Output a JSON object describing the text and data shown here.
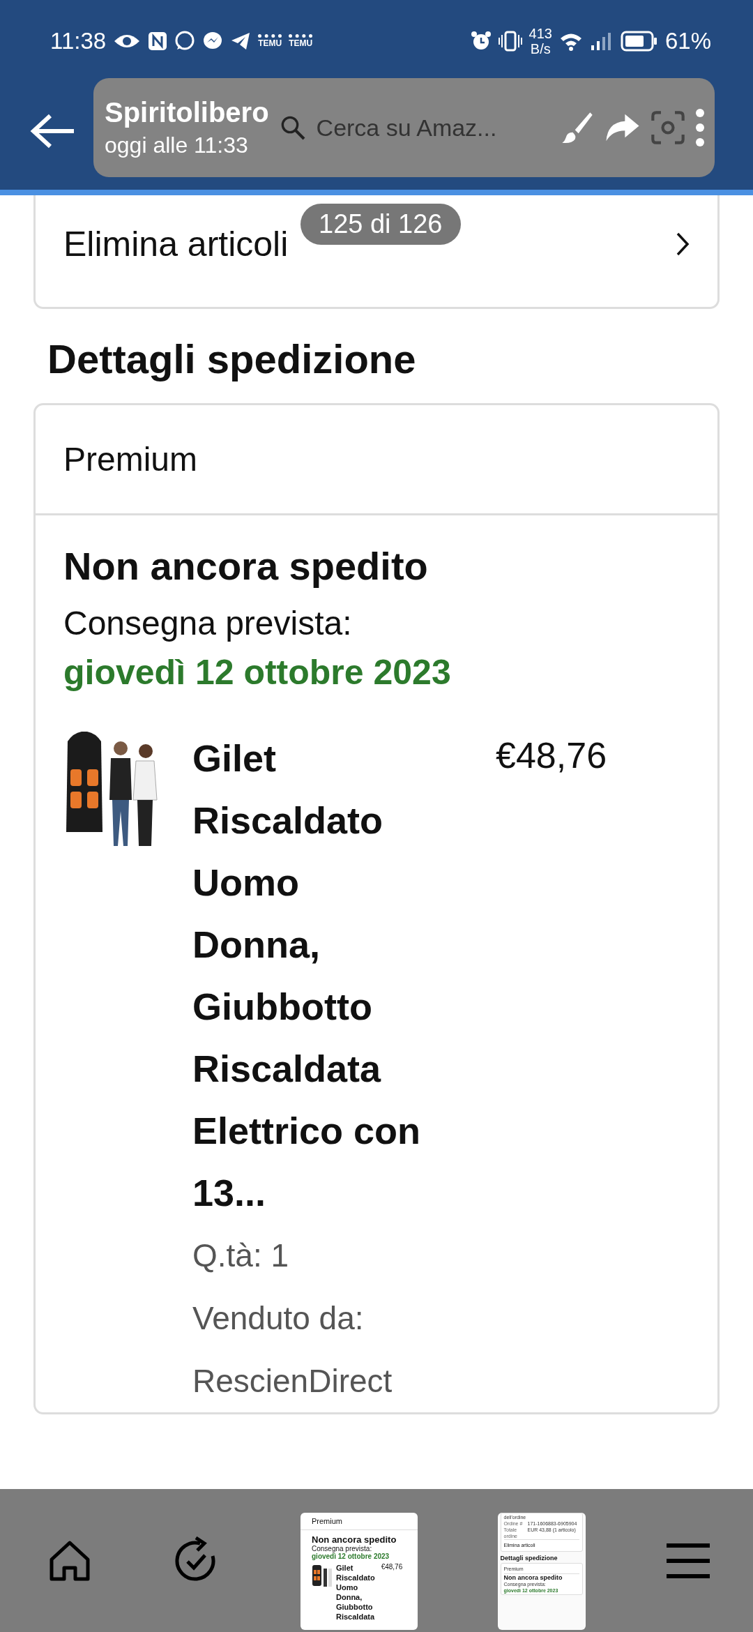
{
  "status_bar": {
    "time": "11:38",
    "app_labels": [
      "TEMU",
      "TEMU"
    ],
    "net_speed": [
      "413",
      "B/s"
    ],
    "battery": "61%"
  },
  "search": {
    "placeholder": "Cerca su Amaz..."
  },
  "viewer": {
    "sender": "Spiritolibero",
    "sent": "oggi alle 11:33",
    "counter": "125 di 126"
  },
  "order_card": {
    "action": "Elimina articoli"
  },
  "shipping": {
    "title": "Dettagli spedizione",
    "method": "Premium",
    "status": "Non ancora spedito",
    "delivery_label": "Consegna prevista:",
    "delivery_date": "giovedì 12 ottobre 2023",
    "items": [
      {
        "title_lines": [
          "Gilet",
          "Riscaldato",
          "Uomo",
          "Donna,",
          "Giubbotto",
          "Riscaldata",
          "Elettrico con",
          "13..."
        ],
        "price": "€48,76",
        "quantity": "Q.tà: 1",
        "seller_label": "Venduto da:",
        "seller": "RescienDirect"
      }
    ]
  },
  "thumbnails": [
    {
      "kind": "shipment",
      "method": "Premium",
      "status": "Non ancora spedito",
      "delivery_label": "Consegna prevista:",
      "delivery_date": "giovedì 12 ottobre 2023",
      "title_lines": [
        "Gilet",
        "Riscaldato",
        "Uomo",
        "Donna,",
        "Giubbotto",
        "Riscaldata"
      ],
      "price": "€48,76"
    },
    {
      "kind": "order",
      "caption": "dell'ordine",
      "rows": [
        {
          "label": "Ordine #",
          "value": "171-1606883-6905904"
        },
        {
          "label": "Totale ordine",
          "value": "EUR 43,88 (1 articolo)"
        }
      ],
      "action": "Elimina articoli",
      "heading": "Dettagli spedizione",
      "method": "Premium",
      "status": "Non ancora spedito",
      "delivery_label": "Consegna prevista:",
      "delivery_date": "giovedì 12 ottobre 2023"
    }
  ]
}
